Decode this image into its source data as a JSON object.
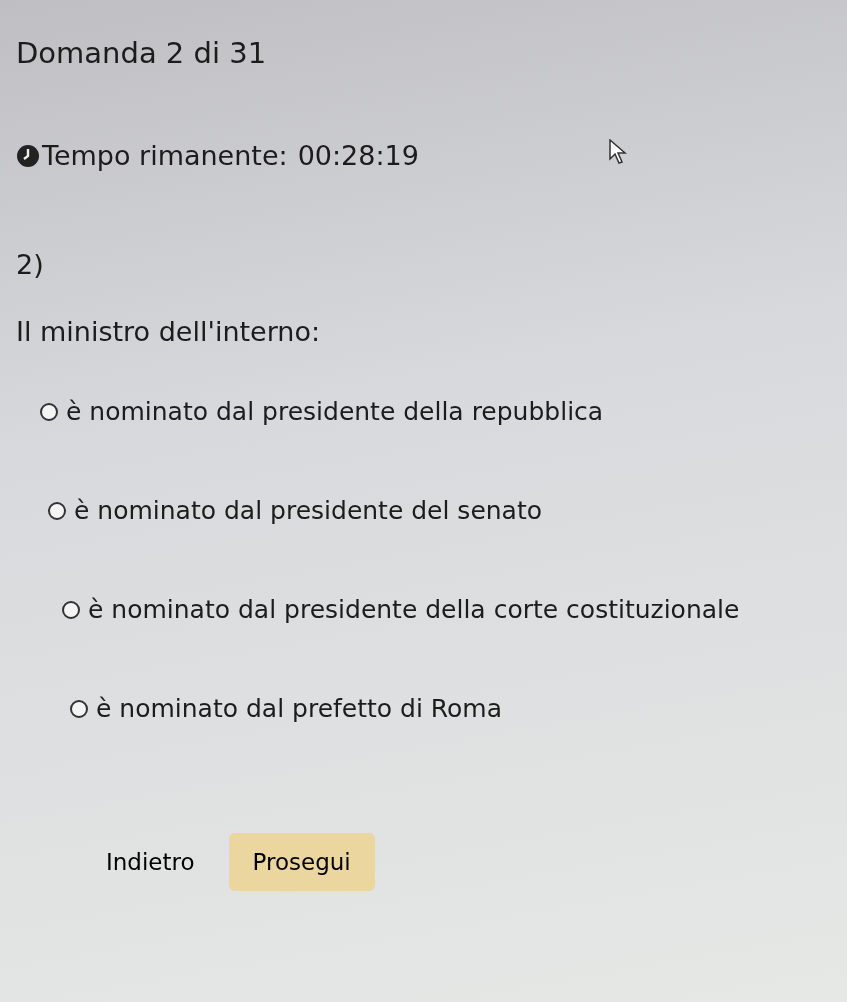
{
  "header": {
    "title": "Domanda 2 di 31",
    "timer_label": "Tempo rimanente:",
    "timer_value": "00:28:19"
  },
  "question": {
    "number": "2)",
    "text": "Il ministro dell'interno:"
  },
  "options": [
    {
      "label": "è nominato dal presidente della repubblica",
      "selected": false
    },
    {
      "label": "è nominato dal presidente del senato",
      "selected": false
    },
    {
      "label": "è nominato dal presidente della corte costituzionale",
      "selected": false
    },
    {
      "label": "è nominato dal prefetto di Roma",
      "selected": false
    }
  ],
  "buttons": [
    {
      "kind": "link",
      "label": "Indietro"
    },
    {
      "kind": "primary",
      "label": "Prosegui"
    }
  ]
}
